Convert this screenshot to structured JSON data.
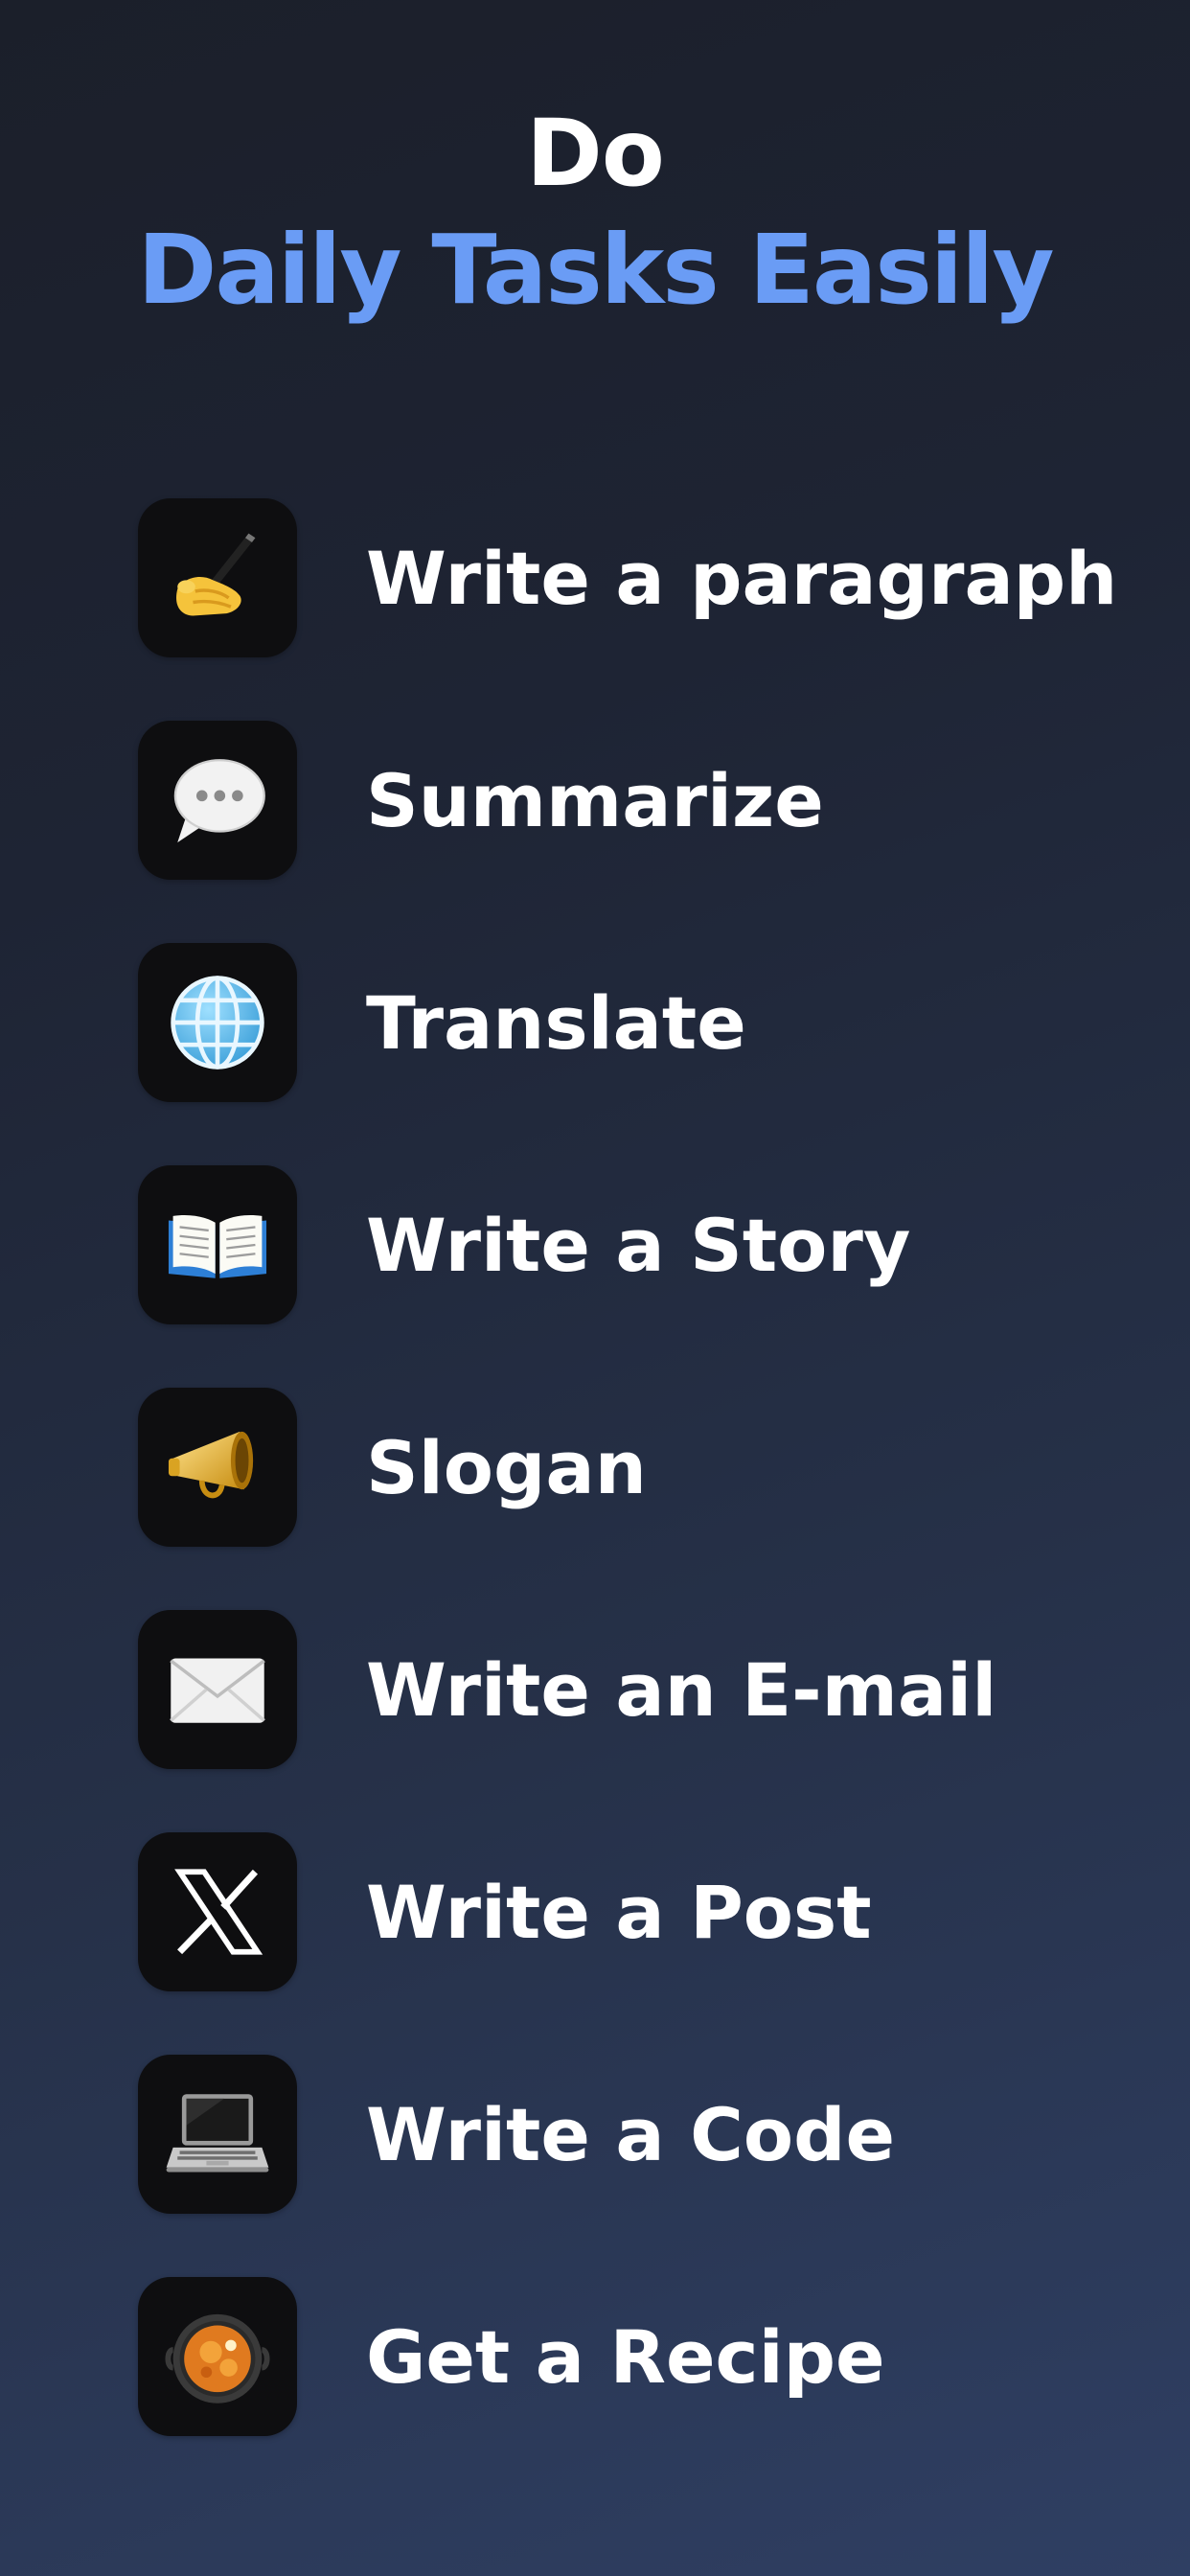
{
  "header": {
    "line1": "Do",
    "line2": "Daily Tasks Easily",
    "accent_color": "#6a9cf5"
  },
  "tasks": [
    {
      "label": "Write a paragraph",
      "icon": "writing-hand-icon"
    },
    {
      "label": "Summarize",
      "icon": "speech-bubble-icon"
    },
    {
      "label": "Translate",
      "icon": "globe-icon"
    },
    {
      "label": "Write a Story",
      "icon": "open-book-icon"
    },
    {
      "label": "Slogan",
      "icon": "megaphone-icon"
    },
    {
      "label": "Write an E-mail",
      "icon": "envelope-icon"
    },
    {
      "label": "Write a Post",
      "icon": "x-logo-icon"
    },
    {
      "label": "Write a Code",
      "icon": "laptop-icon"
    },
    {
      "label": "Get a Recipe",
      "icon": "cooking-pan-icon"
    }
  ]
}
